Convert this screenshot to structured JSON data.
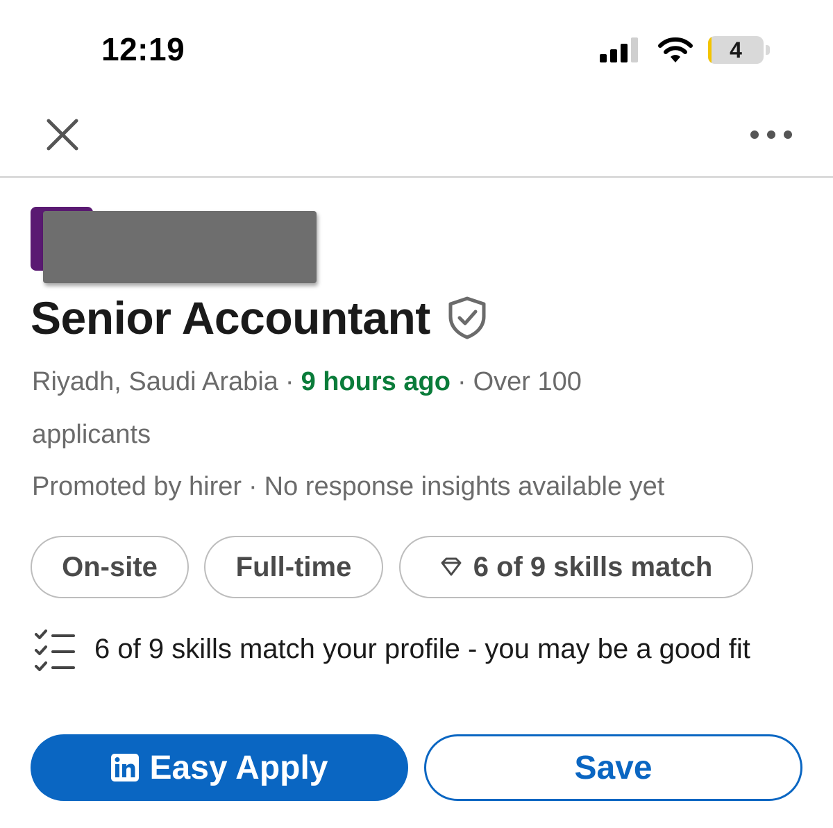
{
  "status_bar": {
    "time": "12:19",
    "battery_level": "4",
    "battery_fraction": 0.04,
    "battery_color": "#f3c400"
  },
  "nav": {
    "close_icon": "close-icon",
    "more_icon": "more-horizontal-icon"
  },
  "company": {
    "logo_color": "#5a1a72",
    "name_redacted": true
  },
  "job": {
    "title": "Senior Accountant",
    "verified_icon": "shield-check-icon",
    "location": "Riyadh, Saudi Arabia",
    "sep": "·",
    "posted": "9 hours ago",
    "applicants_part1": "Over 100",
    "applicants_part2": "applicants",
    "promoted": "Promoted by hirer",
    "response": "No response insights available yet",
    "accent_green": "#0a7c3a"
  },
  "pills": {
    "workplace": "On-site",
    "job_type": "Full-time",
    "skills": "6 of 9 skills match",
    "skills_icon": "diamond-icon"
  },
  "insight": {
    "icon": "checklist-icon",
    "text": "6 of 9 skills match your profile - you may be a good fit"
  },
  "actions": {
    "apply_label": "Easy Apply",
    "apply_icon": "linkedin-icon",
    "save_label": "Save",
    "brand_blue": "#0a66c2"
  }
}
